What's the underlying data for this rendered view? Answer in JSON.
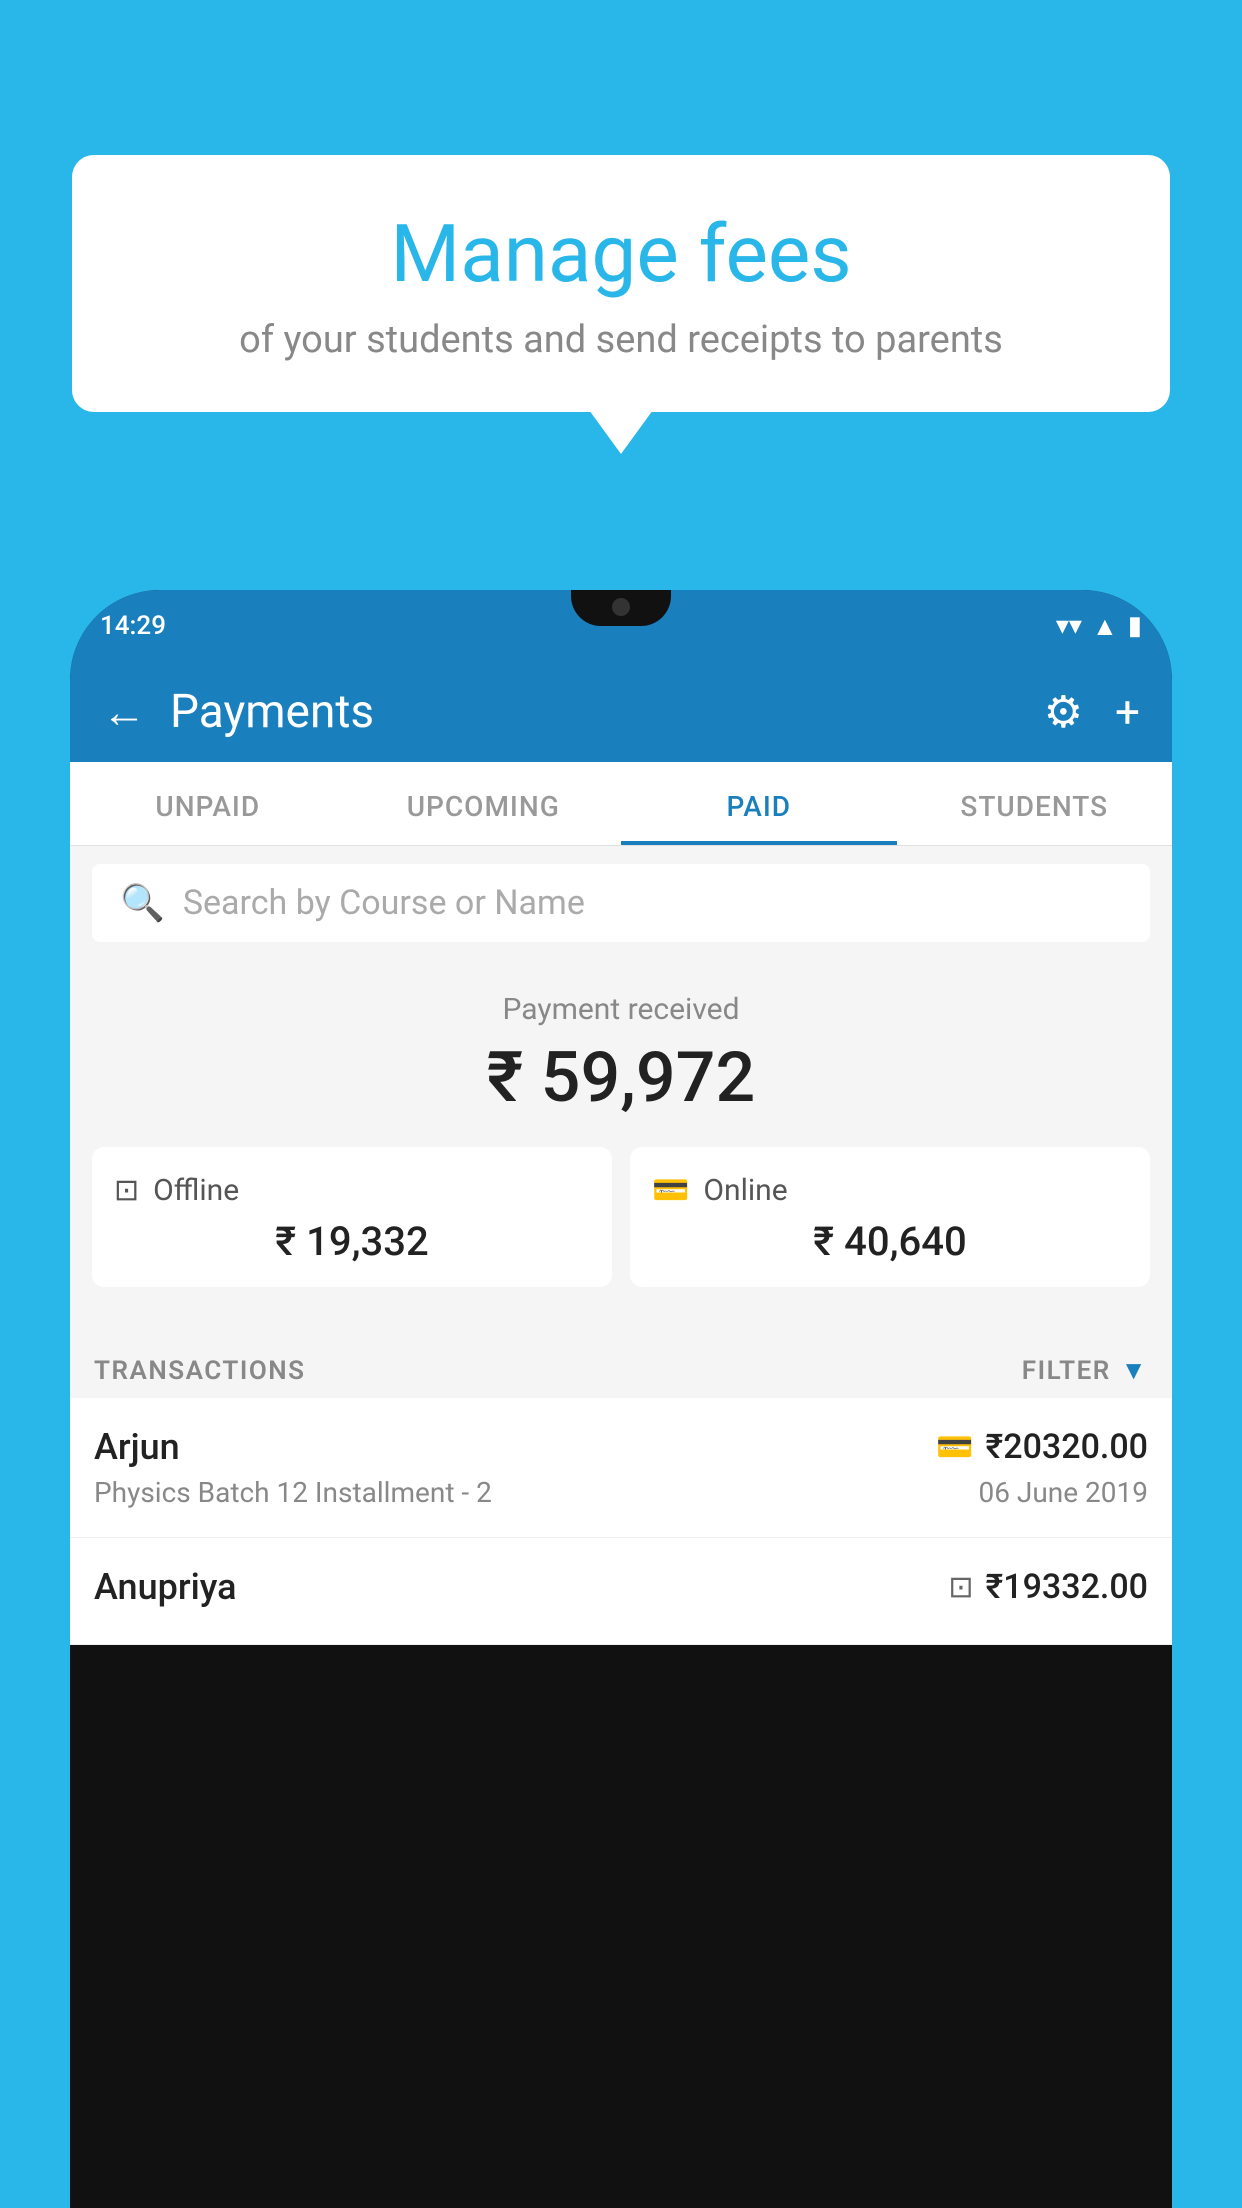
{
  "background_color": "#29b6e8",
  "speech_bubble": {
    "title": "Manage fees",
    "subtitle": "of your students and send receipts to parents"
  },
  "status_bar": {
    "time": "14:29",
    "wifi": "▼",
    "signal": "▲",
    "battery": "▐"
  },
  "app_header": {
    "title": "Payments",
    "back_label": "←",
    "gear_label": "⚙",
    "plus_label": "+"
  },
  "tabs": [
    {
      "label": "UNPAID",
      "active": false
    },
    {
      "label": "UPCOMING",
      "active": false
    },
    {
      "label": "PAID",
      "active": true
    },
    {
      "label": "STUDENTS",
      "active": false
    }
  ],
  "search": {
    "placeholder": "Search by Course or Name"
  },
  "payment_received": {
    "label": "Payment received",
    "amount": "₹ 59,972"
  },
  "payment_cards": [
    {
      "label": "Offline",
      "amount": "₹ 19,332",
      "icon": "offline"
    },
    {
      "label": "Online",
      "amount": "₹ 40,640",
      "icon": "online"
    }
  ],
  "transactions_header": {
    "label": "TRANSACTIONS",
    "filter_label": "FILTER"
  },
  "transactions": [
    {
      "name": "Arjun",
      "course": "Physics Batch 12 Installment - 2",
      "amount": "₹20320.00",
      "date": "06 June 2019",
      "payment_type": "online"
    },
    {
      "name": "Anupriya",
      "course": "",
      "amount": "₹19332.00",
      "date": "",
      "payment_type": "offline"
    }
  ]
}
